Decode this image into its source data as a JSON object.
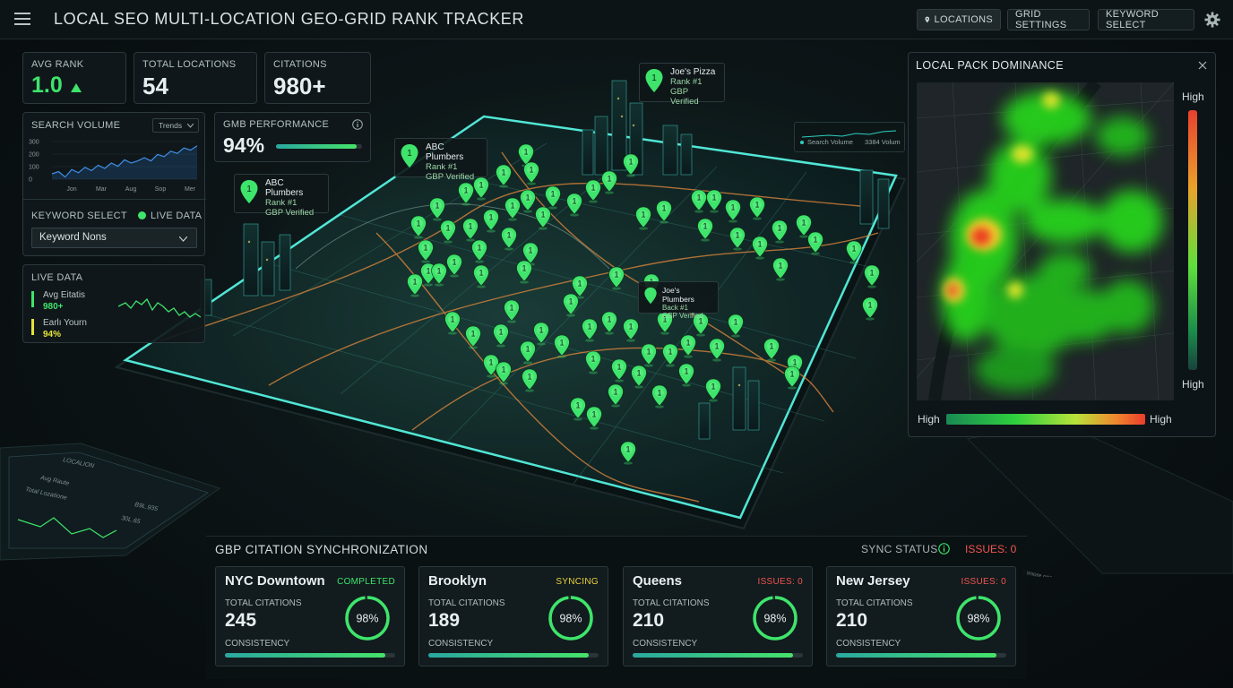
{
  "app": {
    "title": "LOCAL SEO MULTI-LOCATION GEO-GRID RANK TRACKER"
  },
  "topnav": {
    "locations": "LOCATIONS",
    "grid_settings": "GRID SETTINGS",
    "keyword_select": "KEYWORD SELECT"
  },
  "kpis": {
    "avg_rank": {
      "label": "AVG RANK",
      "value": "1.0"
    },
    "total_locations": {
      "label": "TOTAL LOCATIONS",
      "value": "54"
    },
    "citations": {
      "label": "CITATIONS",
      "value": "980+"
    }
  },
  "search_volume": {
    "label": "SEARCH VOLUME",
    "dropdown": "Trends",
    "y_ticks": [
      "300",
      "200",
      "100",
      "0"
    ],
    "x_ticks": [
      "Jon",
      "Mar",
      "Aug",
      "Sop",
      "Mer"
    ]
  },
  "gmb": {
    "label": "GMB PERFORMANCE",
    "value": "94%",
    "progress": 0.94
  },
  "keyword_select": {
    "label": "KEYWORD SELECT",
    "live_label": "LIVE DATA",
    "value": "Keyword Nons"
  },
  "live_data": {
    "label": "LIVE DATA",
    "items": [
      {
        "name": "Avg Eitatis",
        "value": "980+",
        "color": "#3ee46b"
      },
      {
        "name": "Earlı Yourn",
        "value": "94%",
        "color": "#e5e23a"
      }
    ]
  },
  "pins": [
    {
      "name": "Joe's Pizza",
      "rank": "Rank #1",
      "status": "GBP Verified"
    },
    {
      "name": "ABC Plumbers",
      "rank": "Rank #1",
      "status": "GBP Verified"
    },
    {
      "name": "ABC Plumbers",
      "rank": "Rank #1",
      "status": "GBP Verified"
    },
    {
      "name": "Joe's Plumbers",
      "rank": "Back #1",
      "status": "GBP Verified"
    }
  ],
  "mini_legend": {
    "series1": "Search Volume",
    "series2": "3384 Volum"
  },
  "heatmap": {
    "title": "LOCAL PACK DOMINANCE",
    "scale_top": "High",
    "scale_bottom": "High",
    "legend_left": "High",
    "legend_right": "High"
  },
  "sync": {
    "title": "GBP CITATION SYNCHRONIZATION",
    "status_label": "SYNC STATUS",
    "issues_label": "ISSUES: 0",
    "total_label": "TOTAL CITATIONS",
    "consistency_label": "CONSISTENCY",
    "cards": [
      {
        "location": "NYC Downtown",
        "status": "COMPLETED",
        "status_color": "#3ee46b",
        "total": "245",
        "percent": "98%",
        "consistency": 0.94
      },
      {
        "location": "Brooklyn",
        "status": "SYNCING",
        "status_color": "#e9d23a",
        "total": "189",
        "percent": "98%",
        "consistency": 0.94
      },
      {
        "location": "Queens",
        "status": "ISSUES: 0",
        "status_color": "#f0554f",
        "total": "210",
        "percent": "98%",
        "consistency": 0.94
      },
      {
        "location": "New Jersey",
        "status": "ISSUES: 0",
        "status_color": "#f0554f",
        "total": "210",
        "percent": "98%",
        "consistency": 0.94
      }
    ]
  },
  "icons": {
    "menu": "menu-icon",
    "location": "location-pin-icon",
    "settings": "gear-icon",
    "info": "info-icon",
    "close": "close-icon",
    "chevron": "chevron-down-icon",
    "up": "arrow-up-icon"
  },
  "colors": {
    "accent": "#3ee46b",
    "warning": "#e9d23a",
    "danger": "#f0554f",
    "teal": "#2ccfc1"
  }
}
